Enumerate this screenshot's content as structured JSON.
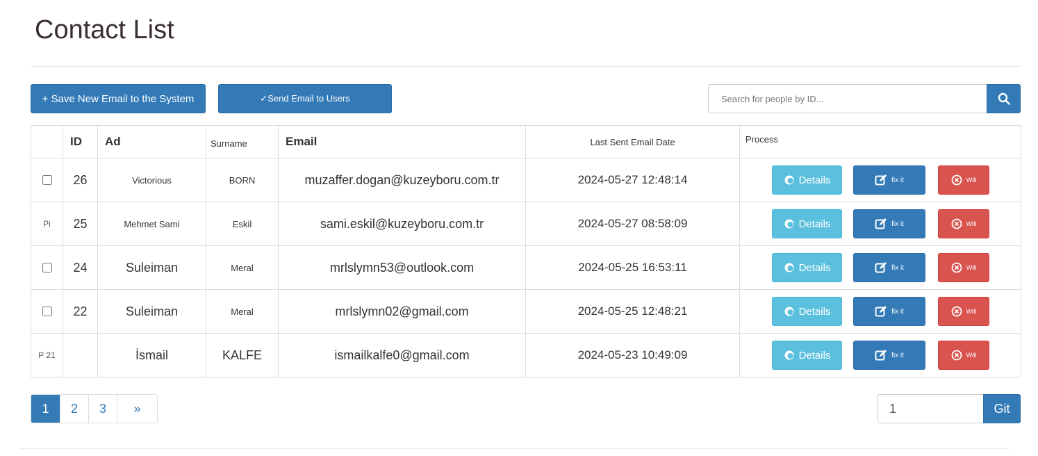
{
  "page": {
    "title": "Contact List"
  },
  "toolbar": {
    "save_label": "+ Save New Email to the System",
    "send_label": "✓Send Email to Users"
  },
  "search": {
    "placeholder": "Search for people by ID...",
    "icon": "search-icon"
  },
  "table": {
    "headers": {
      "id": "ID",
      "ad": "Ad",
      "surname": "Surname",
      "email": "Email",
      "last_sent": "Last Sent Email Date",
      "process": "Process"
    },
    "rows": [
      {
        "checkbox": true,
        "prefix": "",
        "id": "26",
        "ad": "Victorious",
        "surname": "BORN",
        "email": "muzaffer.dogan@kuzeyboru.com.tr",
        "last_sent": "2024-05-27 12:48:14"
      },
      {
        "checkbox": false,
        "prefix": "Pi",
        "id": "25",
        "ad": "Mehmet Sami",
        "surname": "Eskil",
        "email": "sami.eskil@kuzeyboru.com.tr",
        "last_sent": "2024-05-27 08:58:09"
      },
      {
        "checkbox": true,
        "prefix": "",
        "id": "24",
        "ad": "Suleiman",
        "surname": "Meral",
        "email": "mrlslymn53@outlook.com",
        "last_sent": "2024-05-25 16:53:11"
      },
      {
        "checkbox": true,
        "prefix": "",
        "id": "22",
        "ad": "Suleiman",
        "surname": "Meral",
        "email": "mrlslymn02@gmail.com",
        "last_sent": "2024-05-25 12:48:21"
      },
      {
        "checkbox": false,
        "prefix": "P 21",
        "id": "",
        "ad": "İsmail",
        "surname": "KALFE",
        "email": "ismailkalfe0@gmail.com",
        "last_sent": "2024-05-23 10:49:09"
      }
    ],
    "actions": {
      "details": "Details",
      "fix": "fix it",
      "delete": "Will"
    }
  },
  "pagination": {
    "pages": [
      "1",
      "2",
      "3"
    ],
    "next": "»",
    "active": "1"
  },
  "goto": {
    "value": "1",
    "button": "Git"
  },
  "colors": {
    "primary": "#337ab7",
    "info": "#5bc0de",
    "danger": "#d9534f"
  }
}
